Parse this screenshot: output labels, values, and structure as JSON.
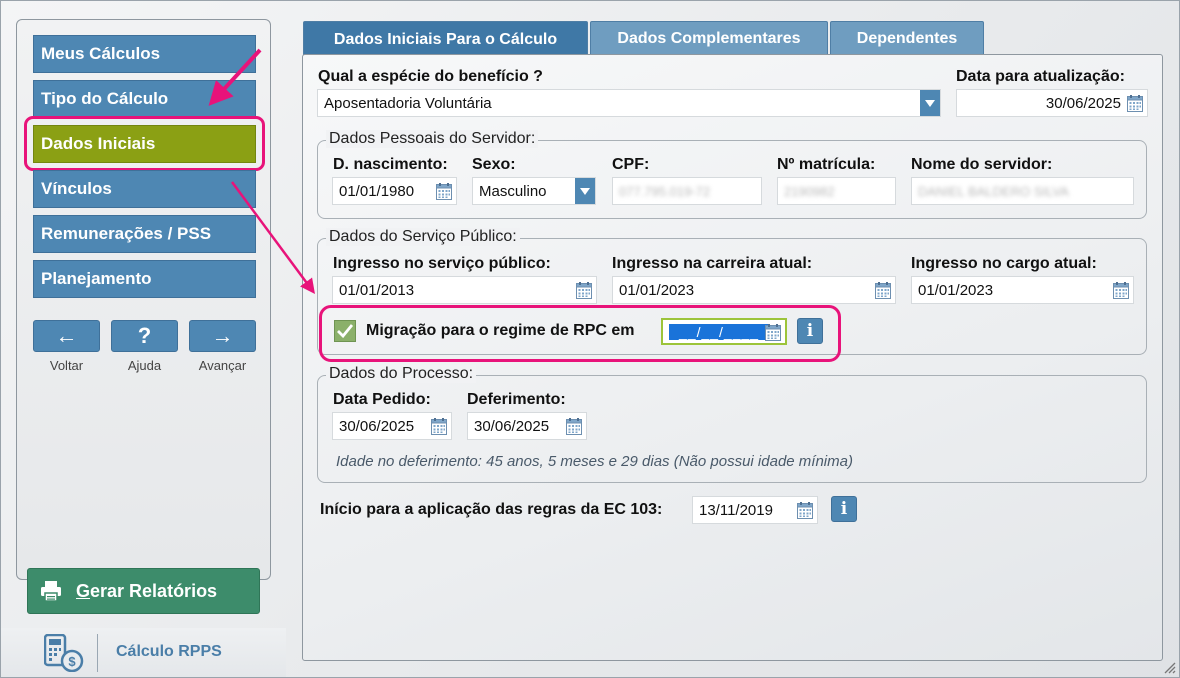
{
  "sidebar": {
    "items": [
      {
        "label": "Meus Cálculos"
      },
      {
        "label": "Tipo do Cálculo"
      },
      {
        "label": "Dados Iniciais"
      },
      {
        "label": "Vínculos"
      },
      {
        "label": "Remunerações / PSS"
      },
      {
        "label": "Planejamento"
      }
    ],
    "active_index": 2,
    "nav_buttons": [
      {
        "glyph": "←",
        "label": "Voltar"
      },
      {
        "glyph": "?",
        "label": "Ajuda"
      },
      {
        "glyph": "→",
        "label": "Avançar"
      }
    ],
    "generate_button": {
      "shortcut": "G",
      "rest": "erar Relatórios"
    },
    "app_name": "Cálculo RPPS"
  },
  "tabs": [
    {
      "label": "Dados Iniciais Para o Cálculo",
      "active": true
    },
    {
      "label": "Dados Complementares",
      "active": false
    },
    {
      "label": "Dependentes",
      "active": false
    }
  ],
  "form": {
    "beneficio_label": "Qual a espécie do benefício ?",
    "beneficio_value": "Aposentadoria Voluntária",
    "data_atualizacao_label": "Data para atualização:",
    "data_atualizacao_value": "30/06/2025",
    "pessoais": {
      "legend": "Dados Pessoais do Servidor:",
      "nasc_label": "D. nascimento:",
      "nasc_value": "01/01/1980",
      "sexo_label": "Sexo:",
      "sexo_value": "Masculino",
      "cpf_label": "CPF:",
      "cpf_value": "077.795.019-72",
      "matricula_label": "Nº matrícula:",
      "matricula_value": "2190982",
      "nome_label": "Nome do servidor:",
      "nome_value": "DANIEL BALDERO SILVA"
    },
    "servico": {
      "legend": "Dados do Serviço Público:",
      "ingresso_label": "Ingresso no serviço público:",
      "ingresso_value": "01/01/2013",
      "carreira_label": "Ingresso na carreira atual:",
      "carreira_value": "01/01/2023",
      "cargo_label": "Ingresso no cargo atual:",
      "cargo_value": "01/01/2023",
      "migracao_label": "Migração para o regime de RPC em",
      "migracao_value": "__/__/____",
      "migracao_checked": true
    },
    "processo": {
      "legend": "Dados do Processo:",
      "pedido_label": "Data Pedido:",
      "pedido_value": "30/06/2025",
      "deferimento_label": "Deferimento:",
      "deferimento_value": "30/06/2025",
      "idade_note": "Idade no deferimento: 45 anos, 5 meses e 29 dias (Não possui idade mínima)"
    },
    "ec103_label": "Início para a aplicação das regras da EC 103:",
    "ec103_value": "13/11/2019"
  },
  "colors": {
    "nav_blue": "#4e87b3",
    "active_green": "#8ba014",
    "highlight_pink": "#e8137a",
    "report_green": "#3d8c6b"
  }
}
